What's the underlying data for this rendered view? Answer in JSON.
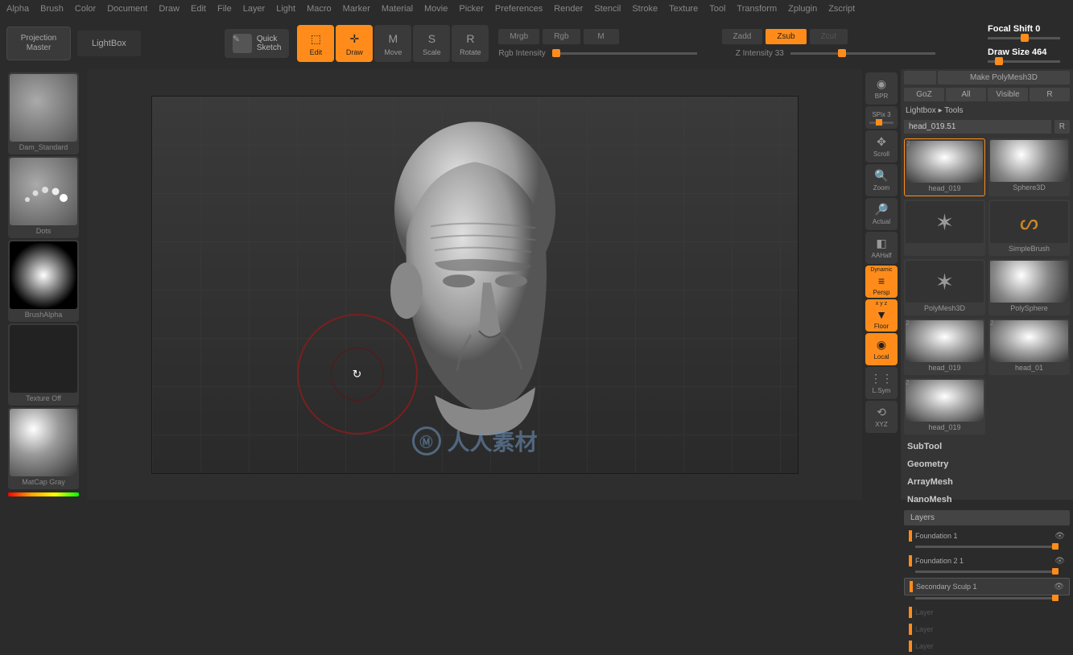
{
  "menu": [
    "Alpha",
    "Brush",
    "Color",
    "Document",
    "Draw",
    "Edit",
    "File",
    "Layer",
    "Light",
    "Macro",
    "Marker",
    "Material",
    "Movie",
    "Picker",
    "Preferences",
    "Render",
    "Stencil",
    "Stroke",
    "Texture",
    "Tool",
    "Transform",
    "Zplugin",
    "Zscript"
  ],
  "toolbar": {
    "projection_master": "Projection\nMaster",
    "lightbox": "LightBox",
    "quick_sketch": "Quick\nSketch",
    "modes": [
      {
        "label": "Edit",
        "active": true
      },
      {
        "label": "Draw",
        "active": true
      },
      {
        "label": "Move",
        "active": false
      },
      {
        "label": "Scale",
        "active": false
      },
      {
        "label": "Rotate",
        "active": false
      }
    ],
    "rgb_modes": [
      {
        "label": "Mrgb",
        "active": false
      },
      {
        "label": "Rgb",
        "active": false
      },
      {
        "label": "M",
        "active": false
      }
    ],
    "rgb_intensity_label": "Rgb Intensity",
    "z_modes": [
      {
        "label": "Zadd",
        "active": false
      },
      {
        "label": "Zsub",
        "active": true
      },
      {
        "label": "Zcut",
        "active": false,
        "dim": true
      }
    ],
    "z_intensity_label": "Z Intensity",
    "z_intensity_value": "33",
    "focal_shift_label": "Focal Shift",
    "focal_shift_value": "0",
    "draw_size_label": "Draw Size",
    "draw_size_value": "464"
  },
  "left_swatches": [
    {
      "label": "Dam_Standard",
      "kind": "brush"
    },
    {
      "label": "Dots",
      "kind": "dots"
    },
    {
      "label": "BrushAlpha",
      "kind": "alpha"
    },
    {
      "label": "Texture Off",
      "kind": "texture"
    },
    {
      "label": "MatCap Gray",
      "kind": "matcap"
    }
  ],
  "rnav": [
    {
      "label": "BPR",
      "icon": "◉",
      "active": false
    },
    {
      "label": "SPix 3",
      "icon": "",
      "active": false,
      "slider": true
    },
    {
      "label": "Scroll",
      "icon": "✥",
      "active": false
    },
    {
      "label": "Zoom",
      "icon": "🔍",
      "active": false
    },
    {
      "label": "Actual",
      "icon": "🔎",
      "active": false
    },
    {
      "label": "AAHalf",
      "icon": "◧",
      "active": false
    },
    {
      "label": "Persp",
      "icon": "≡",
      "active": true,
      "extra": "Dynamic"
    },
    {
      "label": "Floor",
      "icon": "▼",
      "active": true,
      "extra": "x y z"
    },
    {
      "label": "Local",
      "icon": "◉",
      "active": true
    },
    {
      "label": "L.Sym",
      "icon": "⋮⋮",
      "active": false
    },
    {
      "label": "XYZ",
      "icon": "⟲",
      "active": false
    }
  ],
  "right": {
    "top_partial": [
      "",
      "Make PolyMesh3D"
    ],
    "row1": [
      "GoZ",
      "All",
      "Visible",
      "R"
    ],
    "breadcrumb": "Lightbox ▸ Tools",
    "current_tool": "head_019.51",
    "r_badge": "R",
    "tools": [
      {
        "label": "head_019",
        "selected": true,
        "corner": "2",
        "kind": "head"
      },
      {
        "label": "Sphere3D",
        "kind": "sphere"
      },
      {
        "label": "",
        "kind": "star"
      },
      {
        "label": "SimpleBrush",
        "kind": "brush"
      },
      {
        "label": "PolyMesh3D",
        "kind": "star"
      },
      {
        "label": "PolySphere",
        "kind": "sphere"
      },
      {
        "label": "head_019",
        "corner": "2",
        "kind": "head"
      },
      {
        "label": "head_01",
        "corner": "2",
        "kind": "head"
      },
      {
        "label": "head_019",
        "corner": "2",
        "kind": "head",
        "wide": true
      }
    ],
    "sections": [
      "SubTool",
      "Geometry",
      "ArrayMesh",
      "NanoMesh"
    ],
    "layers_header": "Layers",
    "layers": [
      {
        "name": "Foundation 1",
        "value": 1,
        "visible": true
      },
      {
        "name": "Foundation 2 1",
        "value": 1,
        "visible": true
      },
      {
        "name": "Secondary Sculp 1",
        "value": 1,
        "visible": true,
        "selected": true
      },
      {
        "name": "Layer",
        "dim": true
      },
      {
        "name": "Layer",
        "dim": true
      },
      {
        "name": "Layer",
        "dim": true
      }
    ]
  },
  "watermark": "人人素材"
}
